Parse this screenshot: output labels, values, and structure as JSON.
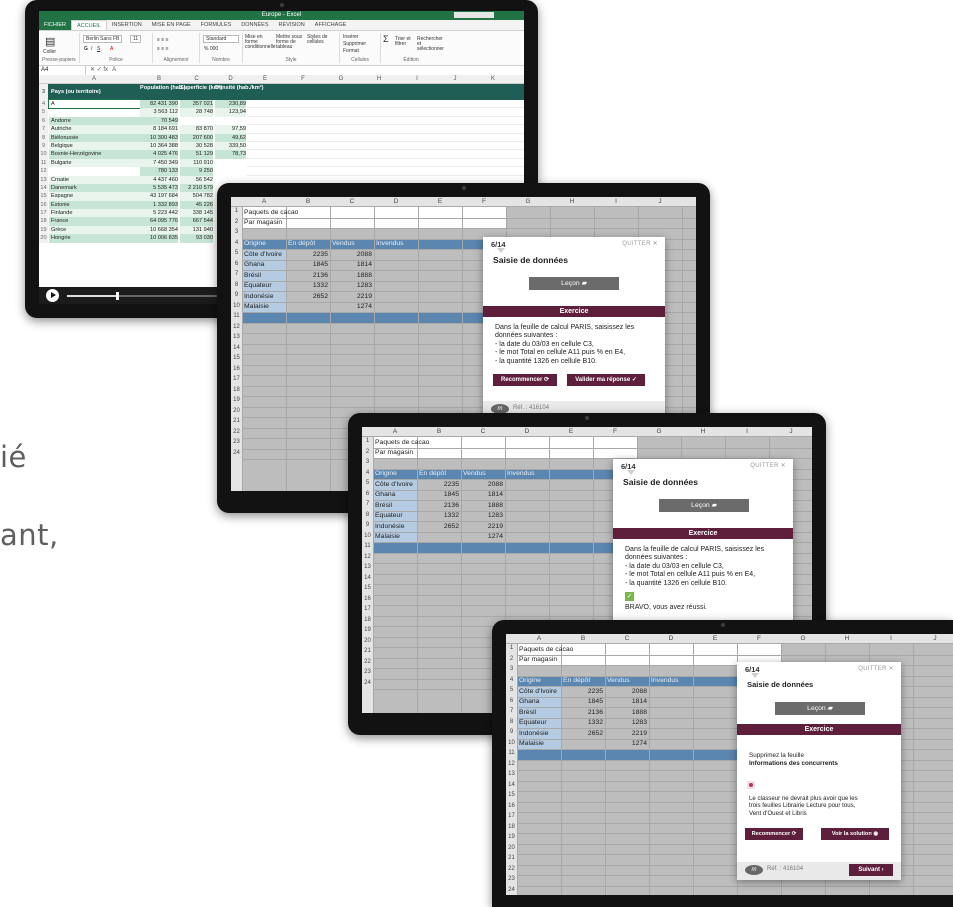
{
  "background_text": {
    "line1": "ié",
    "line2": "ant,"
  },
  "excel": {
    "title": "Europe - Excel",
    "tabs": [
      "FICHIER",
      "ACCUEIL",
      "INSERTION",
      "MISE EN PAGE",
      "FORMULES",
      "DONNÉES",
      "RÉVISION",
      "AFFICHAGE"
    ],
    "ribbon": {
      "font_name": "Berlin Sans FB",
      "font_size": "11",
      "number_format": "Standard",
      "paste": "Coller",
      "groups": [
        "Presse-papiers",
        "Police",
        "Alignement",
        "Nombre",
        "Style",
        "Cellules",
        "Édition"
      ],
      "style_buttons": [
        "Mise en forme conditionnelle",
        "Mettre sous forme de tableau",
        "Styles de cellules"
      ],
      "cells_buttons": [
        "Insérer",
        "Supprimer",
        "Format"
      ],
      "edit_buttons": [
        "Trier et filtrer",
        "Rechercher et sélectionner"
      ]
    },
    "name_box": "A4",
    "formula": "A",
    "columns": [
      "A",
      "B",
      "C",
      "D",
      "E",
      "F",
      "G",
      "H",
      "I",
      "J",
      "K"
    ],
    "header": {
      "row_num": "3",
      "a": "Pays (ou territoire)",
      "b": "Population (hab.)",
      "c": "Superficie (km²)",
      "d": "Densité (hab./km²)"
    },
    "rows": [
      {
        "n": "4",
        "a": "A",
        "b": "82 431 390",
        "c": "357 021",
        "d": "230,89"
      },
      {
        "n": "5",
        "a": "",
        "b": "3 563 112",
        "c": "28 748",
        "d": "123,94"
      },
      {
        "n": "6",
        "a": "Andorre",
        "b": "70 549",
        "c": "",
        "d": ""
      },
      {
        "n": "7",
        "a": "Autriche",
        "b": "8 184 691",
        "c": "83 870",
        "d": "97,59"
      },
      {
        "n": "8",
        "a": "Biélorussie",
        "b": "10 300 483",
        "c": "207 600",
        "d": "49,62"
      },
      {
        "n": "9",
        "a": "Belgique",
        "b": "10 364 388",
        "c": "30 528",
        "d": "339,50"
      },
      {
        "n": "10",
        "a": "Bosnie-Herzégovine",
        "b": "4 025 476",
        "c": "51 129",
        "d": "78,73"
      },
      {
        "n": "11",
        "a": "Bulgarie",
        "b": "7 450 349",
        "c": "110 910",
        "d": ""
      },
      {
        "n": "12",
        "a": "",
        "b": "780 133",
        "c": "9 250",
        "d": ""
      },
      {
        "n": "13",
        "a": "Croatie",
        "b": "4 437 460",
        "c": "56 542",
        "d": ""
      },
      {
        "n": "14",
        "a": "Danemark",
        "b": "5 535 473",
        "c": "2 210 579",
        "d": ""
      },
      {
        "n": "15",
        "a": "Espagne",
        "b": "43 197 684",
        "c": "504 782",
        "d": ""
      },
      {
        "n": "16",
        "a": "Estonie",
        "b": "1 332 893",
        "c": "45 226",
        "d": ""
      },
      {
        "n": "17",
        "a": "Finlande",
        "b": "5 223 442",
        "c": "338 145",
        "d": ""
      },
      {
        "n": "18",
        "a": "France",
        "b": "64 095 776",
        "c": "667 544",
        "d": ""
      },
      {
        "n": "19",
        "a": "Grèce",
        "b": "10 668 354",
        "c": "131 940",
        "d": ""
      },
      {
        "n": "20",
        "a": "Hongrie",
        "b": "10 006 835",
        "c": "93 030",
        "d": ""
      }
    ]
  },
  "sheet": {
    "columns": [
      "A",
      "B",
      "C",
      "D",
      "E",
      "F",
      "G",
      "H",
      "I",
      "J",
      "K"
    ],
    "title1": "Paquets de cacao",
    "title2": "Par magasin",
    "headers": [
      "Origine",
      "En dépôt",
      "Vendus",
      "Invendus"
    ],
    "rows": [
      {
        "origine": "Côte d'Ivoire",
        "depot": "2235",
        "vendus": "2088"
      },
      {
        "origine": "Ghana",
        "depot": "1845",
        "vendus": "1814"
      },
      {
        "origine": "Brésil",
        "depot": "2136",
        "vendus": "1888"
      },
      {
        "origine": "Equateur",
        "depot": "1332",
        "vendus": "1283"
      },
      {
        "origine": "Indonésie",
        "depot": "2652",
        "vendus": "2219"
      },
      {
        "origine": "Malaisie",
        "depot": "",
        "vendus": "1274"
      }
    ]
  },
  "dialog_common": {
    "quit": "QUITTER",
    "section_title": "Saisie de données",
    "lesson": "Leçon",
    "exercise": "Exercice",
    "restart": "Recommencer",
    "ref": "Réf. : 416104",
    "logo": "m"
  },
  "dialog1": {
    "page": "6/14",
    "instructions": [
      "Dans la feuille de calcul PARIS, saisissez les",
      "données suivantes :",
      "- la date du 03/03 en cellule C3,",
      "- le mot Total en cellule A11 puis % en E4,",
      "- la quantité 1326 en cellule B10."
    ],
    "validate": "Valider ma réponse"
  },
  "dialog2": {
    "page": "6/14",
    "instructions": [
      "Dans la feuille de calcul PARIS, saisissez les",
      "données suivantes :",
      "- la date du 03/03 en cellule C3,",
      "- le mot Total en cellule A11 puis % en E4,",
      "- la quantité 1326 en cellule B10."
    ],
    "success": "BRAVO, vous avez réussi."
  },
  "dialog3": {
    "page": "6/14",
    "instruction_1": "Supprimez la feuille",
    "instruction_2": "Informations des concurrents",
    "feedback_1": "Le classeur ne devrait plus avoir que les",
    "feedback_2": "trois feuilles Librairie Lecture pour tous,",
    "feedback_3": "Vent d'Ouest et Libris",
    "solution": "Voir la solution",
    "next": "Suivant"
  },
  "colors": {
    "accent": "#5e1f3c",
    "excel_green": "#217346",
    "table_blue": "#5b86b0",
    "success_green": "#7ab648"
  },
  "video": {
    "progress": 0.12
  }
}
